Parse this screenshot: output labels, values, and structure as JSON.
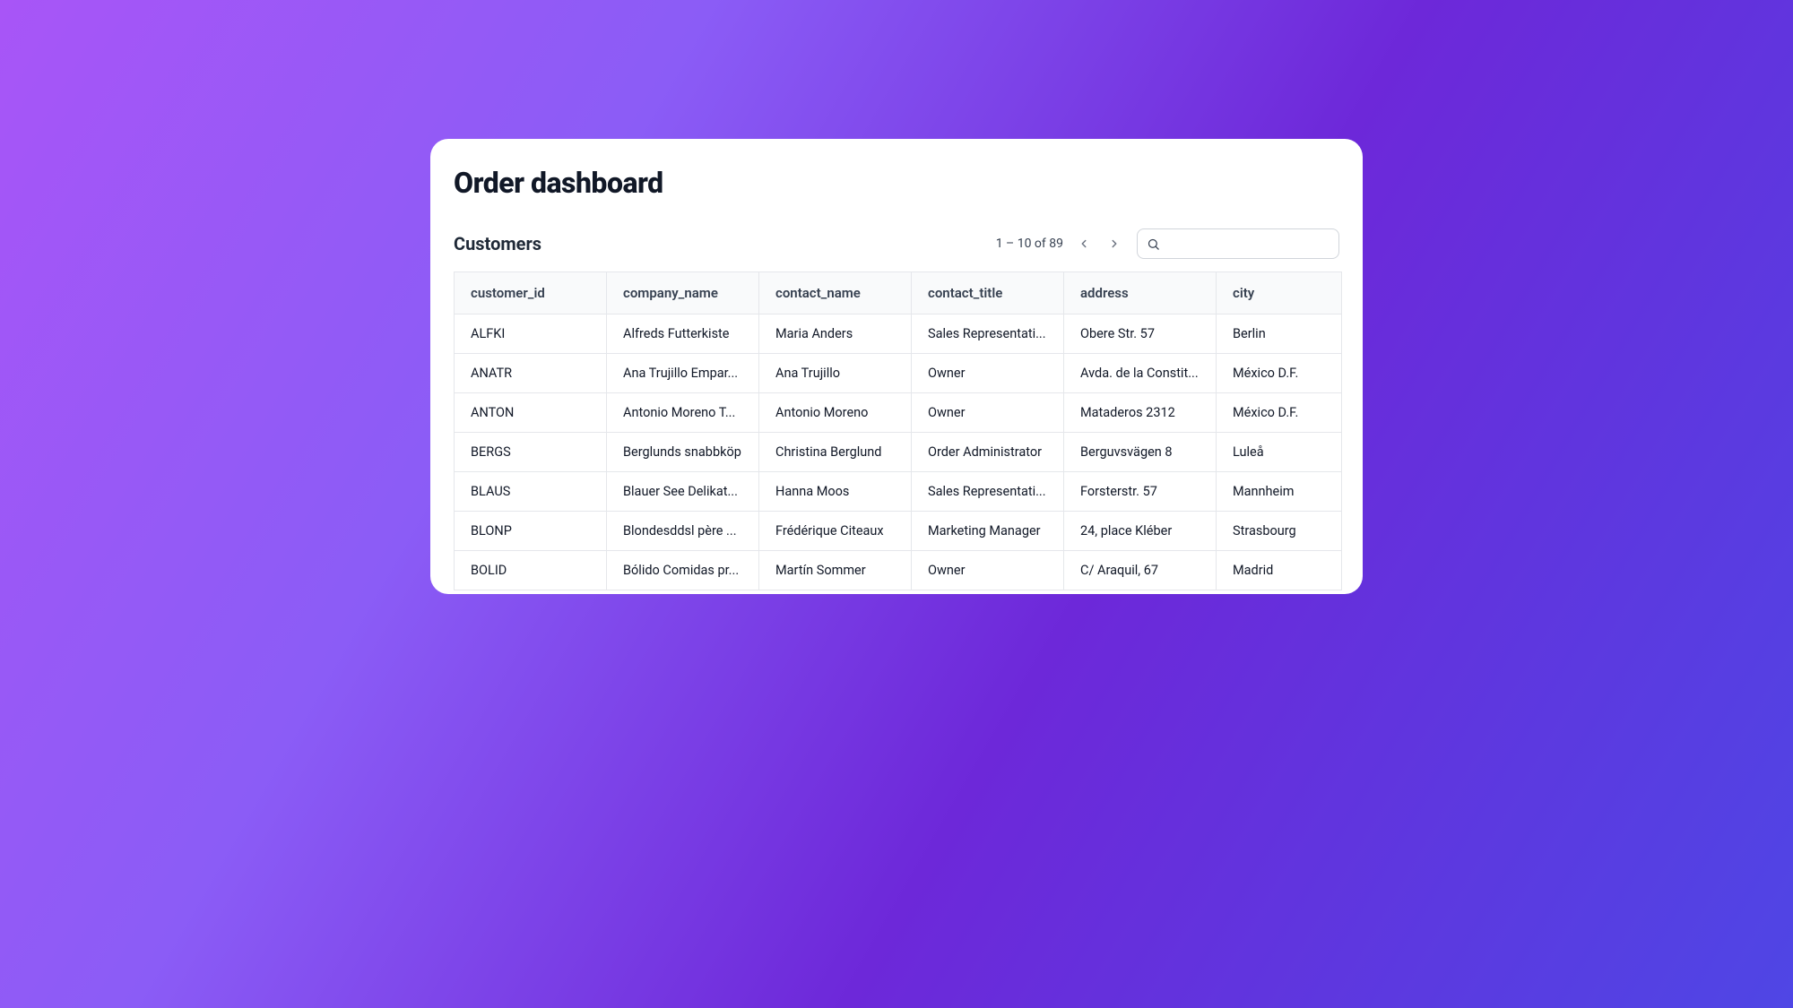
{
  "page": {
    "title": "Order dashboard"
  },
  "section": {
    "title": "Customers"
  },
  "pagination": {
    "label": "1 – 10 of 89"
  },
  "search": {
    "value": "",
    "placeholder": ""
  },
  "table": {
    "columns": [
      "customer_id",
      "company_name",
      "contact_name",
      "contact_title",
      "address",
      "city"
    ],
    "rows": [
      {
        "customer_id": "ALFKI",
        "company_name": "Alfreds Futterkiste",
        "contact_name": "Maria Anders",
        "contact_title": "Sales Representati...",
        "address": "Obere Str. 57",
        "city": "Berlin"
      },
      {
        "customer_id": "ANATR",
        "company_name": "Ana Trujillo Empar...",
        "contact_name": "Ana Trujillo",
        "contact_title": "Owner",
        "address": "Avda. de la Constit...",
        "city": "México D.F."
      },
      {
        "customer_id": "ANTON",
        "company_name": "Antonio Moreno T...",
        "contact_name": "Antonio Moreno",
        "contact_title": "Owner",
        "address": "Mataderos 2312",
        "city": "México D.F."
      },
      {
        "customer_id": "BERGS",
        "company_name": "Berglunds snabbköp",
        "contact_name": "Christina Berglund",
        "contact_title": "Order Administrator",
        "address": "Berguvsvägen 8",
        "city": "Luleå"
      },
      {
        "customer_id": "BLAUS",
        "company_name": "Blauer See Delikat...",
        "contact_name": "Hanna Moos",
        "contact_title": "Sales Representati...",
        "address": "Forsterstr. 57",
        "city": "Mannheim"
      },
      {
        "customer_id": "BLONP",
        "company_name": "Blondesddsl père ...",
        "contact_name": "Frédérique Citeaux",
        "contact_title": "Marketing Manager",
        "address": "24, place Kléber",
        "city": "Strasbourg"
      },
      {
        "customer_id": "BOLID",
        "company_name": "Bólido Comidas pr...",
        "contact_name": "Martín Sommer",
        "contact_title": "Owner",
        "address": "C/ Araquil, 67",
        "city": "Madrid"
      }
    ]
  }
}
